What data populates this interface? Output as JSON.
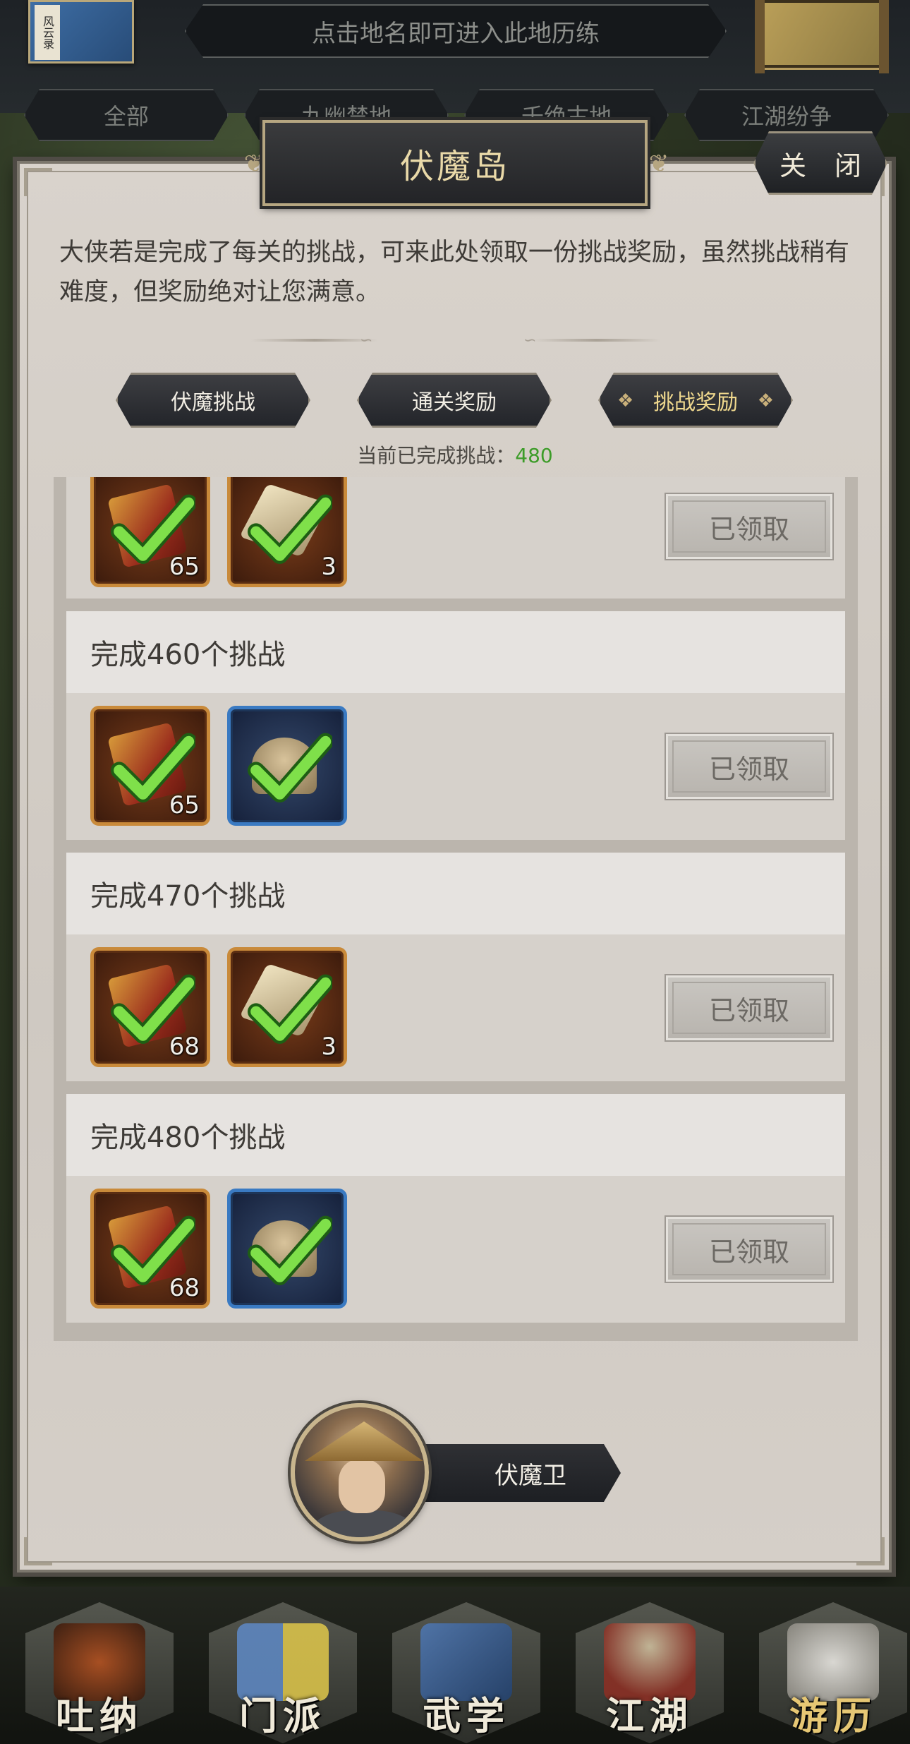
{
  "top": {
    "map_book_label": "风云录",
    "hint": "点击地名即可进入此地历练",
    "filter_tabs": [
      "全部",
      "九幽禁地",
      "千绝古地",
      "江湖纷争"
    ]
  },
  "dialog": {
    "title": "伏魔岛",
    "close_label": "关 闭",
    "description": "大侠若是完成了每关的挑战，可来此处领取一份挑战奖励，虽然挑战稍有难度，但奖励绝对让您满意。",
    "tabs": [
      {
        "label": "伏魔挑战",
        "active": false
      },
      {
        "label": "通关奖励",
        "active": false
      },
      {
        "label": "挑战奖励",
        "active": true
      }
    ],
    "progress_label": "当前已完成挑战：",
    "progress_value": "480"
  },
  "rewards": [
    {
      "title": "",
      "items": [
        {
          "icon": "scroll-icon",
          "count": "65",
          "frame": "orange"
        },
        {
          "icon": "paper-icon",
          "count": "3",
          "frame": "orange"
        }
      ],
      "button": "已领取",
      "claimed": true
    },
    {
      "title": "完成460个挑战",
      "items": [
        {
          "icon": "scroll-icon",
          "count": "65",
          "frame": "orange"
        },
        {
          "icon": "hat-icon",
          "count": "",
          "frame": "blue"
        }
      ],
      "button": "已领取",
      "claimed": true
    },
    {
      "title": "完成470个挑战",
      "items": [
        {
          "icon": "scroll-icon",
          "count": "68",
          "frame": "orange"
        },
        {
          "icon": "paper-icon",
          "count": "3",
          "frame": "orange"
        }
      ],
      "button": "已领取",
      "claimed": true
    },
    {
      "title": "完成480个挑战",
      "items": [
        {
          "icon": "scroll-icon",
          "count": "68",
          "frame": "orange"
        },
        {
          "icon": "hat-icon",
          "count": "",
          "frame": "blue"
        }
      ],
      "button": "已领取",
      "claimed": true
    }
  ],
  "npc": {
    "name": "伏魔卫"
  },
  "bottom_nav": [
    {
      "label": "吐纳",
      "active": false
    },
    {
      "label": "门派",
      "active": false
    },
    {
      "label": "武学",
      "active": false
    },
    {
      "label": "江湖",
      "active": false
    },
    {
      "label": "游历",
      "active": true
    }
  ],
  "colors": {
    "progress_value": "#3c9c28",
    "active_tab_text": "#f0d98e",
    "check_green": "#7fe04a"
  }
}
